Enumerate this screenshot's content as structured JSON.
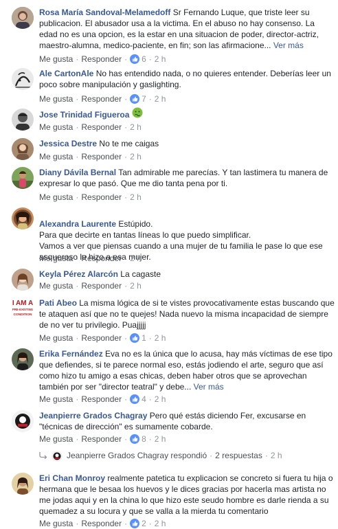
{
  "actions": {
    "like": "Me gusta",
    "reply": "Responder",
    "see_more": "Ver más",
    "dot": "·"
  },
  "comments": [
    {
      "name": "Rosa María Sandoval-Melamedoff",
      "text": "Sr Fernando Luque, que triste leer su publicacion. El abusador usa a la victima. En el abuso no hay consenso. La edad no es una opcion, es la estar en una situacion de poder, director-actriz, maestro-alumna, medico-paciente, en fin; son las afirmacione... ",
      "see_more": "Ver más",
      "reactions": "6",
      "time": "2 h"
    },
    {
      "name": "Ale CartonAle",
      "text": "No has entendido nada, o no quieres entender. Deberías leer un poco sobre manipulación y gaslighting.",
      "reactions": "7",
      "time": "2 h"
    },
    {
      "name": "Jose Trinidad Figueroa",
      "text": "",
      "emoji": "nauseated-face-icon",
      "time": "2 h"
    },
    {
      "name": "Jessica Destre",
      "text": "No te me caigas",
      "time": "2 h"
    },
    {
      "name": "Diany Dávila Bernal",
      "text": "Tan admirable me parecías. Y tan lastimera tu manera de expresar lo que pasó. Que me dio tanta pena por ti.",
      "time": "2 h"
    },
    {
      "name": "Alexandra Laurente",
      "text": "Estúpido.\nPara que decirte en tantas líneas lo que puedo simplificar.\nVamos a ver que piensas cuando a una mujer de tu familia le pase lo que ese asqueroso le hizo a esa mujer.",
      "time": "2 h"
    },
    {
      "name": "Keyla Pérez Alarcón",
      "text": "La cagaste",
      "time": "2 h"
    },
    {
      "name": "Pati Abeo",
      "text": "La misma lógica de si te vistes provocativamente estas buscando que te ataquen así que no te quejes! Nada nuevo la misma incapacidad de siempre de no ver tu privilegio. Puajjjjj",
      "reactions": "1",
      "time": "2 h",
      "avatar_text": [
        "I AM A",
        "PRE-EXISTING",
        "CONDITION"
      ]
    },
    {
      "name": "Erika Fernández",
      "text": "Eva no es la única que lo acusa, hay más víctimas de ese tipo que defiendes, si te parece normal eso, estás jodiendo el arte, seguro que así como hizo tu amigo a esas chicas, deben haber otros que se aprovechan también por ser \"director teatral\" y debe... ",
      "see_more": "Ver más",
      "reactions": "4",
      "time": "2 h"
    },
    {
      "name": "Jeanpierre Grados Chagray",
      "text": "Pero qué estás diciendo Fer, excusarse en \"técnicas de dirección\" es sumamente cobarde.",
      "reactions": "8",
      "time": "2 h",
      "replies": {
        "name": "Jeanpierre Grados Chagray",
        "action": "respondió",
        "count": "2 respuestas",
        "time": "2 h"
      }
    },
    {
      "name": "Eri Chan Monroy",
      "text": "realmente patetica tu explicacion se concreto si fuera tu hija o hermana que le besaa los huevos y le dices gracias por hacerla mas artista no me jodas aqui y en la china lo que hizo este seudo hombre es darle rienda a su quemadez a su locura y que se valla a la mierda tu comentario",
      "reactions": "2",
      "time": "2 h"
    }
  ]
}
